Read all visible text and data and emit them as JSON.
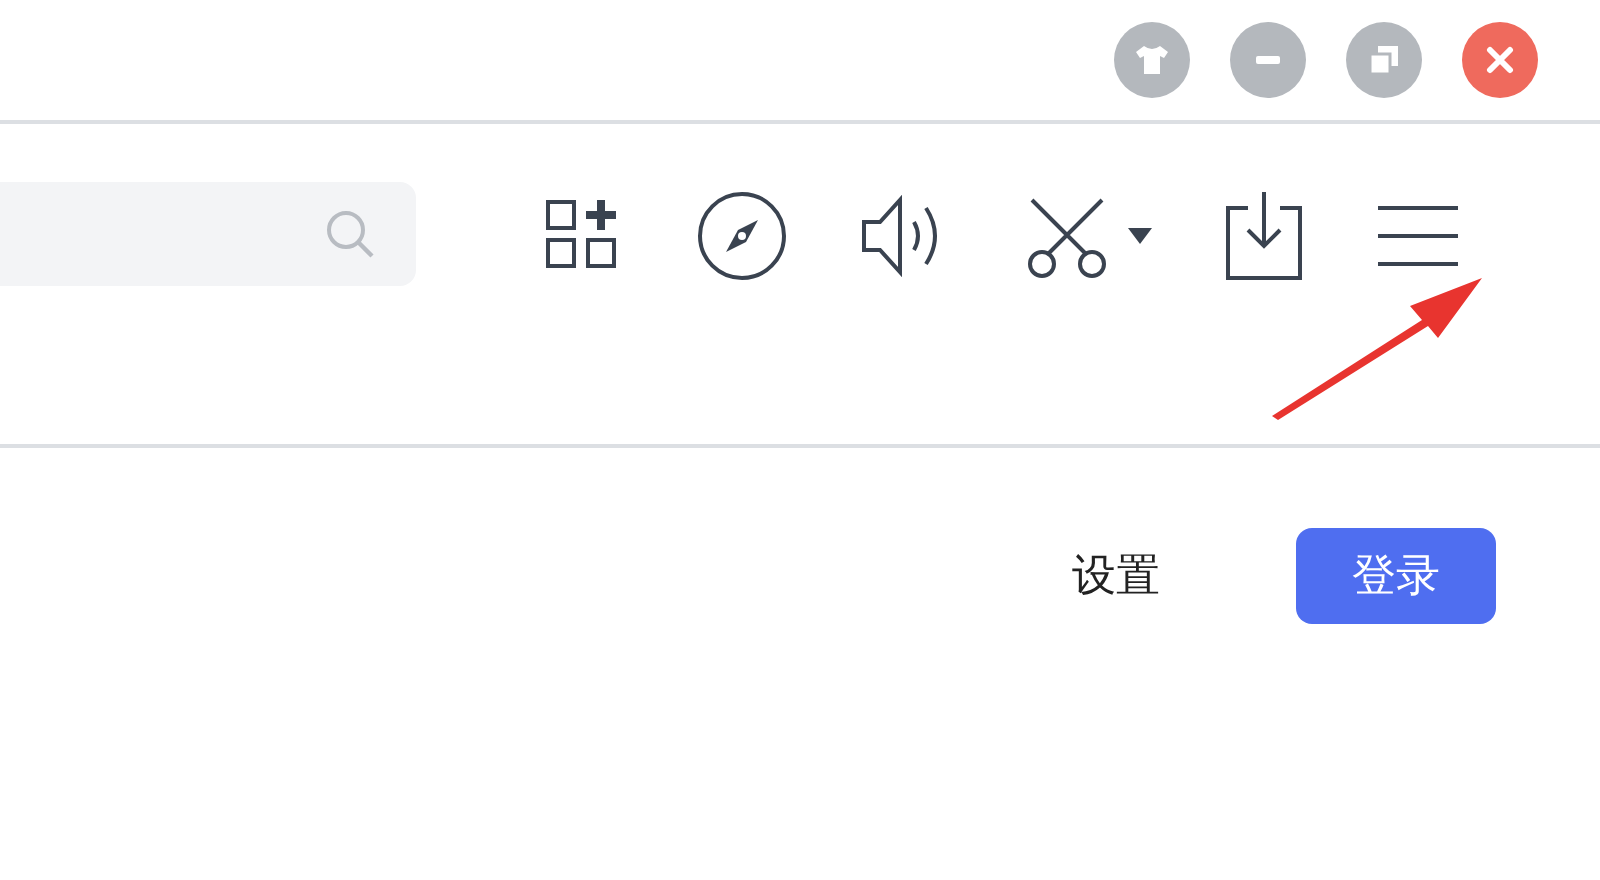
{
  "settings_link": "设置",
  "login_button": "登录"
}
